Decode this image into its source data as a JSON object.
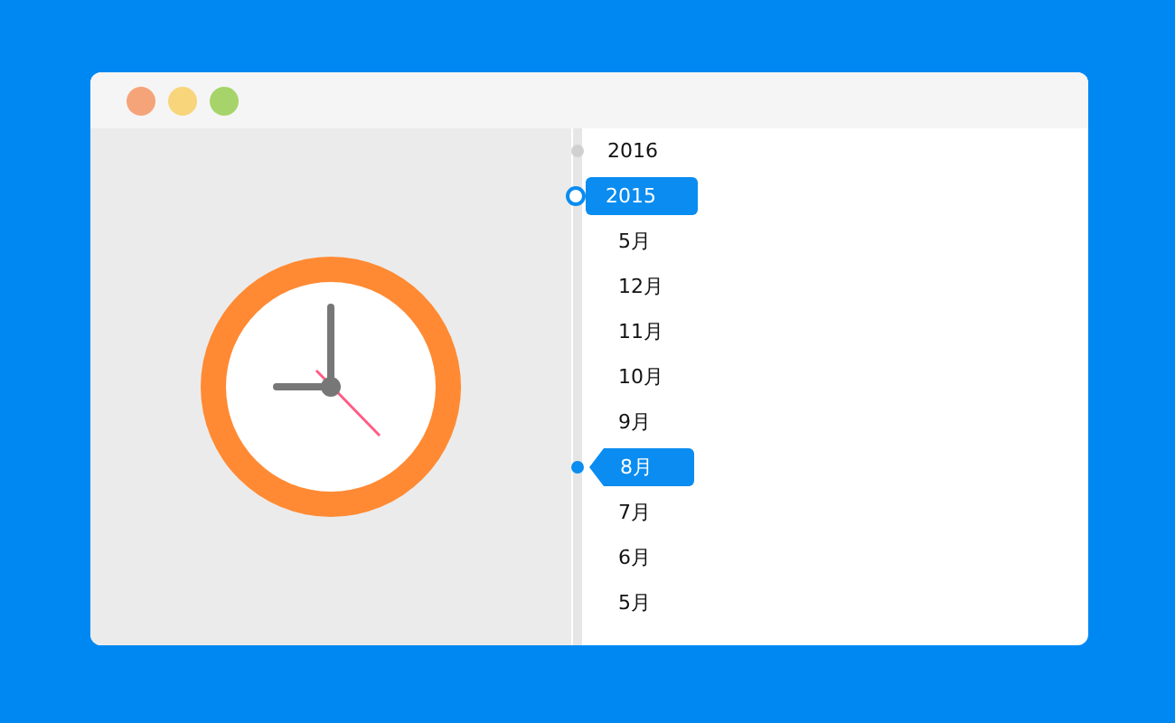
{
  "window": {
    "controls": [
      {
        "color": "#f5a47a"
      },
      {
        "color": "#f8d57a"
      },
      {
        "color": "#a6d46a"
      }
    ]
  },
  "timeline": [
    {
      "label": "2016",
      "kind": "year",
      "selected": false
    },
    {
      "label": "2015",
      "kind": "year",
      "selected": true
    },
    {
      "label": "5月",
      "kind": "month",
      "selected": false
    },
    {
      "label": "12月",
      "kind": "month",
      "selected": false
    },
    {
      "label": "11月",
      "kind": "month",
      "selected": false
    },
    {
      "label": "10月",
      "kind": "month",
      "selected": false
    },
    {
      "label": "9月",
      "kind": "month",
      "selected": false
    },
    {
      "label": "8月",
      "kind": "month",
      "selected": true
    },
    {
      "label": "7月",
      "kind": "month",
      "selected": false
    },
    {
      "label": "6月",
      "kind": "month",
      "selected": false
    },
    {
      "label": "5月",
      "kind": "month",
      "selected": false
    }
  ]
}
